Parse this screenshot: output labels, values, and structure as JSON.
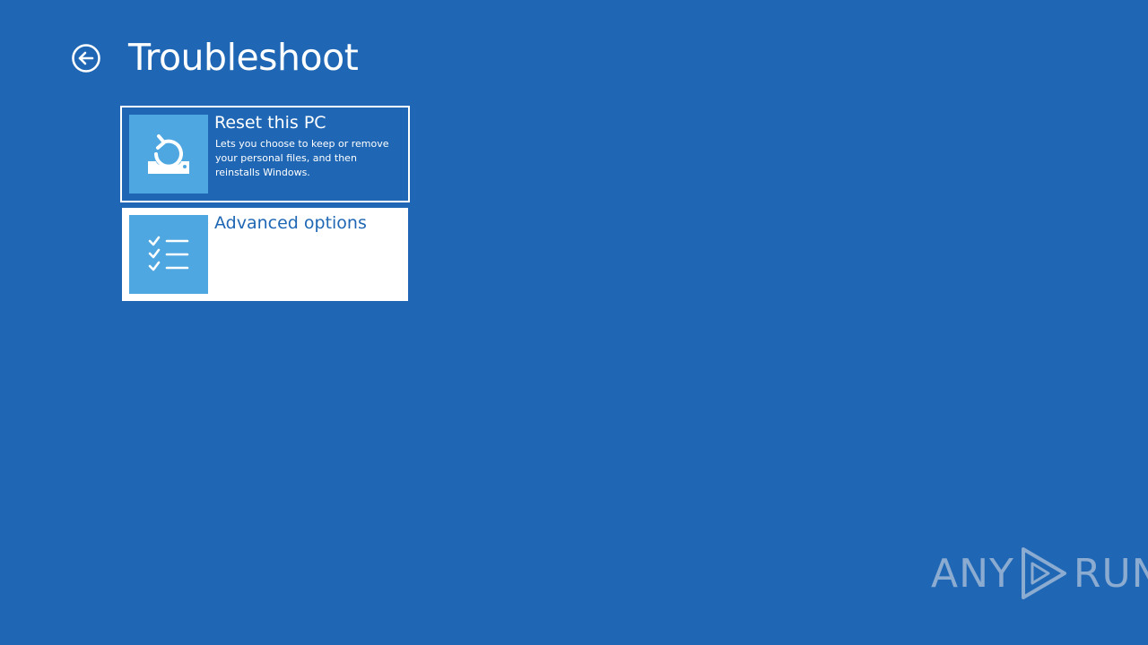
{
  "header": {
    "title": "Troubleshoot",
    "back_icon": "back-arrow-circle-icon"
  },
  "options": [
    {
      "title": "Reset this PC",
      "description": "Lets you choose to keep or remove your personal files, and then reinstalls Windows.",
      "icon": "reset-pc-icon",
      "selected": true
    },
    {
      "title": "Advanced options",
      "description": "",
      "icon": "checklist-icon",
      "selected": false
    }
  ],
  "watermark": {
    "left_text": "ANY",
    "right_text": "RUN",
    "icon": "play-triangle-icon"
  },
  "colors": {
    "background": "#1f67b4",
    "tile_icon_background": "#4ea7e1",
    "text": "#ffffff"
  }
}
